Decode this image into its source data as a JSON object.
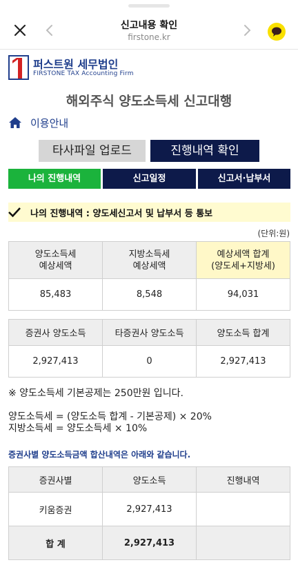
{
  "browser": {
    "title": "신고내용 확인",
    "url": "firstone.kr"
  },
  "logo": {
    "name": "퍼스트원 세무법인",
    "subtitle": "FIRSTONE TAX Accounting Firm"
  },
  "page_title": "해외주식 양도소득세 신고대행",
  "guide_link": "이용안내",
  "buttons": {
    "upload": "타사파일 업로드",
    "progress": "진행내역 확인"
  },
  "tabs": [
    {
      "label": "나의 진행내역",
      "active": true
    },
    {
      "label": "신고일정",
      "active": false
    },
    {
      "label": "신고서·납부서",
      "active": false
    }
  ],
  "notice": "나의 진행내역 : 양도세신고서 및 납부서 등 통보",
  "unit": "(단위:원)",
  "tax_table": {
    "headers": [
      "양도소득세\n예상세액",
      "지방소득세\n예상세액",
      "예상세액 합계\n(양도세+지방세)"
    ],
    "values": [
      "85,483",
      "8,548",
      "94,031"
    ]
  },
  "income_table": {
    "headers": [
      "증권사 양도소득",
      "타증권사 양도소득",
      "양도소득 합계"
    ],
    "values": [
      "2,927,413",
      "0",
      "2,927,413"
    ]
  },
  "notes": {
    "deduction": "※ 양도소득세 기본공제는 250만원 입니다.",
    "formula1": "양도소득세 = (양도소득 합계 - 기본공제) × 20%",
    "formula2": "지방소득세 = 양도소득세 × 10%"
  },
  "breakdown_title": "증권사별 양도소득금액 합산내역은 아래와 같습니다.",
  "breakdown_table": {
    "headers": [
      "증권사별",
      "양도소득",
      "진행내역"
    ],
    "rows": [
      [
        "키움증권",
        "2,927,413",
        ""
      ],
      [
        "합 계",
        "2,927,413",
        ""
      ]
    ]
  },
  "colors": {
    "navy": "#0d1a4a",
    "green": "#1bb33c",
    "brand_blue": "#1f3e8c",
    "highlight": "#fff8c8",
    "kakao_yellow": "#f9e000"
  },
  "icons": [
    "close-icon",
    "back-arrow-icon",
    "forward-arrow-icon",
    "kakaotalk-icon",
    "home-icon",
    "check-icon"
  ]
}
